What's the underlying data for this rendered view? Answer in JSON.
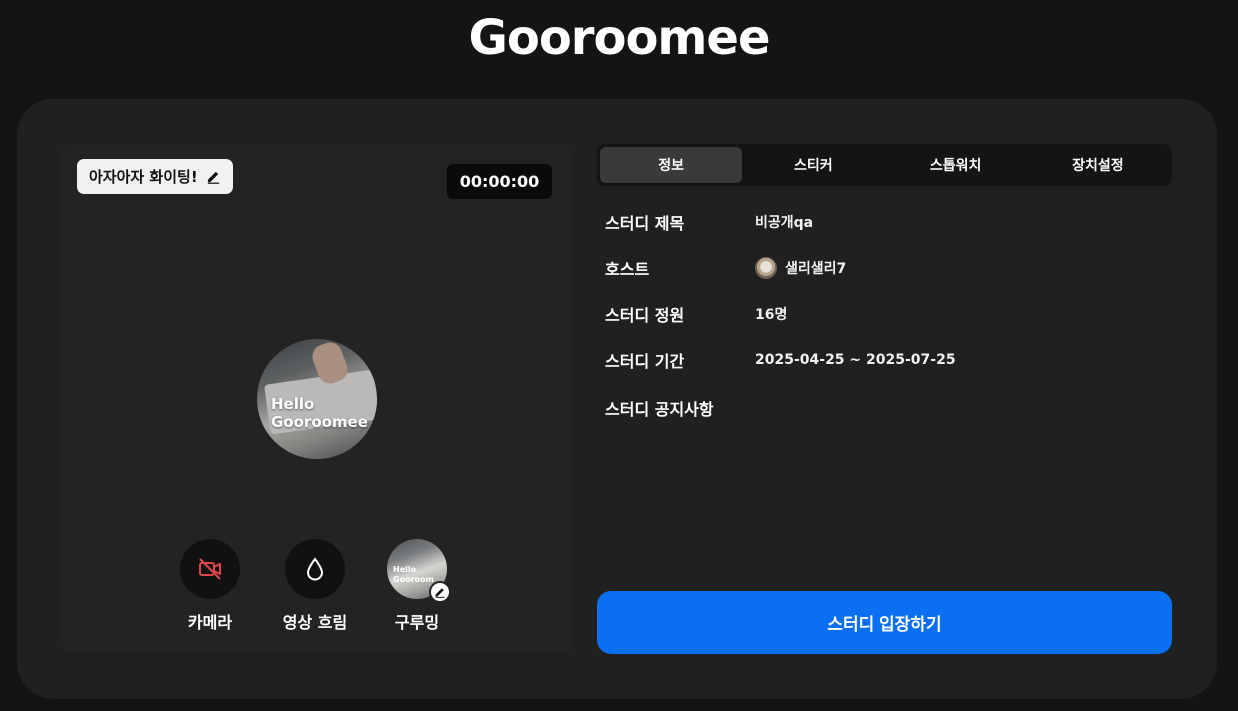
{
  "brand": {
    "logo_text": "Gooroomee"
  },
  "preview": {
    "status_message": "아자아자 화이팅!",
    "timer": "00:00:00",
    "avatar_text_line1": "Hello",
    "avatar_text_line2": "Gooroomee",
    "controls": [
      {
        "label": "카메라",
        "icon": "camera-off-icon",
        "color": "#e0474c"
      },
      {
        "label": "영상 흐림",
        "icon": "droplet-icon"
      },
      {
        "label": "구루밍",
        "icon": "gooroomee-thumbnail",
        "thumb_text_line1": "Hello",
        "thumb_text_line2": "Gooroom"
      }
    ]
  },
  "tabs": [
    {
      "label": "정보",
      "active": true
    },
    {
      "label": "스티커",
      "active": false
    },
    {
      "label": "스톱워치",
      "active": false
    },
    {
      "label": "장치설정",
      "active": false
    }
  ],
  "info": {
    "title_label": "스터디 제목",
    "title_value": "비공개qa",
    "host_label": "호스트",
    "host_value": "샐리샐리7",
    "capacity_label": "스터디 정원",
    "capacity_value": "16명",
    "period_label": "스터디 기간",
    "period_value": "2025-04-25 ~ 2025-07-25",
    "notice_label": "스터디 공지사항",
    "notice_value": ""
  },
  "enter_button": {
    "label": "스터디 입장하기",
    "color": "#0a6ff0"
  }
}
